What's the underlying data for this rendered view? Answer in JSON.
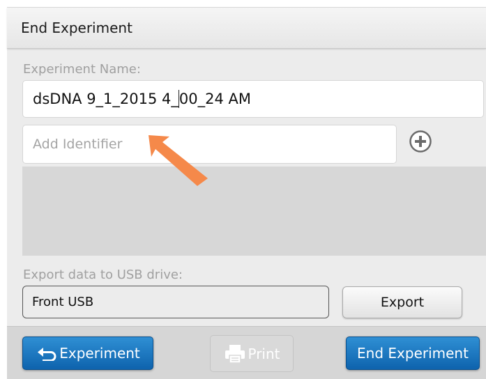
{
  "dialog": {
    "title": "End Experiment"
  },
  "experiment_name": {
    "label": "Experiment Name:",
    "value_before_cursor": "dsDNA 9_1_2015 4_",
    "value_after_cursor": "00_24 AM"
  },
  "identifier": {
    "placeholder": "Add Identifier",
    "add_icon": "plus-circle-icon"
  },
  "export": {
    "label": "Export data to USB drive:",
    "drive": "Front USB",
    "button_label": "Export"
  },
  "bottom_bar": {
    "back_label": "Experiment",
    "back_icon": "return-arrow-icon",
    "print_label": "Print",
    "print_icon": "printer-icon",
    "end_label": "End Experiment"
  },
  "colors": {
    "primary_button": "#1a75c0",
    "annotation_arrow": "#f5894a"
  }
}
